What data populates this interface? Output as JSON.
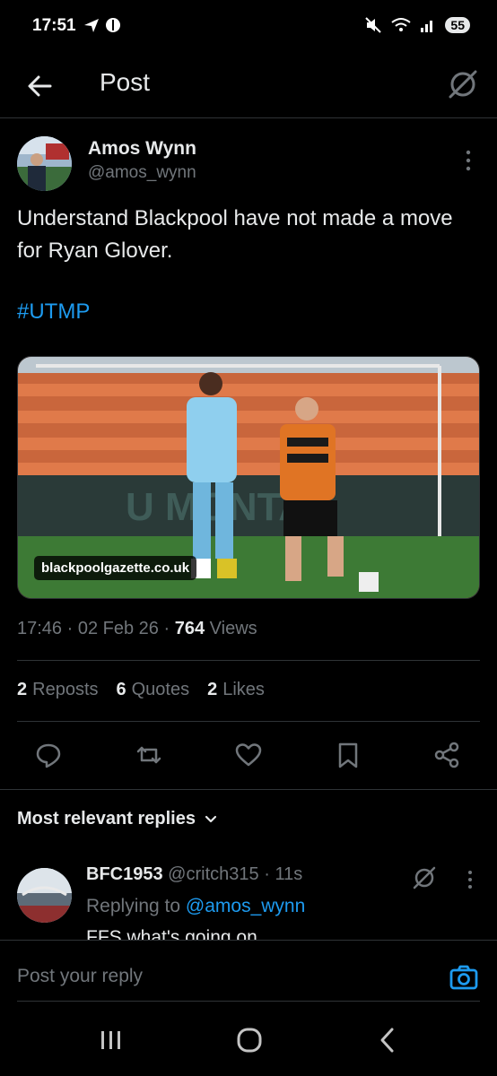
{
  "status_bar": {
    "time": "17:51",
    "battery": "55"
  },
  "header": {
    "title": "Post"
  },
  "post": {
    "author_name": "Amos Wynn",
    "author_handle": "@amos_wynn",
    "text": "Understand Blackpool have not made a move for Ryan Glover.",
    "hashtag": "#UTMP",
    "media_source": "blackpoolgazette.co.uk",
    "time": "17:46",
    "date": "02 Feb 26",
    "views_count": "764",
    "views_label": "Views",
    "reposts_count": "2",
    "reposts_label": "Reposts",
    "quotes_count": "6",
    "quotes_label": "Quotes",
    "likes_count": "2",
    "likes_label": "Likes"
  },
  "replies_section": {
    "label": "Most relevant replies"
  },
  "reply": {
    "name": "BFC1953",
    "handle": "@critch315",
    "time": "11s",
    "replying_prefix": "Replying to",
    "replying_to": "@amos_wynn",
    "text": "FFS what's going on"
  },
  "composer": {
    "placeholder": "Post your reply"
  },
  "colors": {
    "accent": "#1d9bf0",
    "background": "#000000",
    "secondary_text": "#71767b"
  }
}
